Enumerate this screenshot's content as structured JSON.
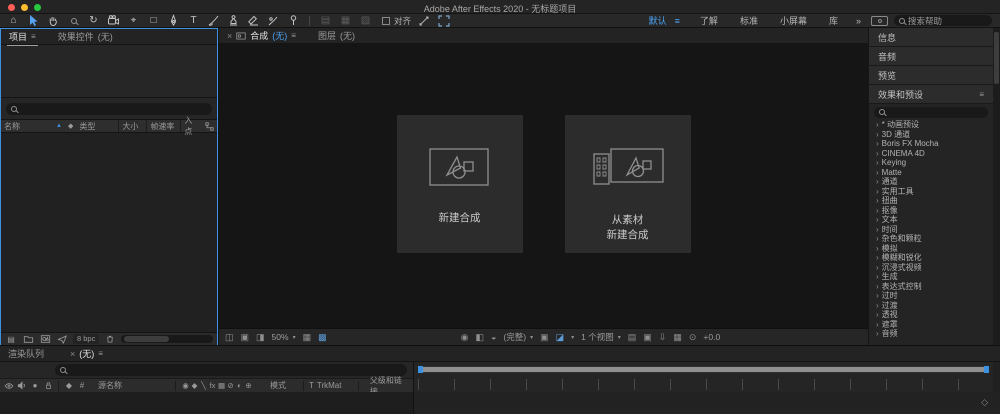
{
  "titlebar": {
    "title": "Adobe After Effects 2020 - 无标题项目"
  },
  "toolbar": {
    "align_label": "对齐",
    "workspaces": [
      "默认",
      "了解",
      "标准",
      "小屏幕",
      "库"
    ],
    "overflow_icon": "»",
    "help_search_placeholder": "搜索帮助"
  },
  "icons": {
    "home": "⌂",
    "rotate": "↻",
    "pan_behind": "⌖",
    "rect_tool": "□",
    "text_tool": "T",
    "menu": "≡",
    "close": "×",
    "sort_asc": "▲",
    "label_tag": "◆",
    "hash": "#",
    "solo": "●",
    "grayed_tools": [
      "▤",
      "▦",
      "▧"
    ],
    "switches": [
      "◉",
      "◆",
      "╲",
      "fx",
      "▦",
      "⊘",
      "◐",
      "⊕"
    ],
    "viewer_left": [
      "◫",
      "▣",
      "◨"
    ],
    "grid": "▦",
    "mask_vis": "▩",
    "snapshot": "◉",
    "show_snapshot": "◧",
    "channels": "◒",
    "roi": "▣",
    "transparency": "◪",
    "pixel_aspect": "▤",
    "fast_preview": "▣",
    "mini_timeline": "⇩",
    "flowchart": "▦",
    "reset_exposure": "⊙",
    "dropdown": "▾",
    "nav_hand": "◇"
  },
  "project_panel": {
    "tabs": {
      "project": "项目",
      "effect_controls": "效果控件",
      "effect_controls_suffix": "(无)"
    },
    "columns": {
      "name": "名称",
      "type": "类型",
      "size": "大小",
      "frame_rate": "帧速率",
      "in_point": "入点"
    },
    "bit_depth": "8 bpc"
  },
  "comp_panel": {
    "tabs": {
      "comp": "合成",
      "comp_suffix": "(无)",
      "layer": "图层",
      "layer_suffix": "(无)"
    },
    "new_comp_label": "新建合成",
    "from_footage_line1": "从素材",
    "from_footage_line2": "新建合成",
    "status": {
      "zoom": "50%",
      "resolution": "(完整)",
      "views": "1 个视图",
      "exposure": "+0.0"
    }
  },
  "right_panel": {
    "info_label": "信息",
    "audio_label": "音频",
    "preview_label": "预览",
    "effects_title": "效果和预设",
    "effects": [
      "* 动画预设",
      "3D 通道",
      "Boris FX Mocha",
      "CINEMA 4D",
      "Keying",
      "Matte",
      "通道",
      "实用工具",
      "扭曲",
      "抠像",
      "文本",
      "时间",
      "杂色和颗粒",
      "模拟",
      "模糊和锐化",
      "沉浸式视频",
      "生成",
      "表达式控制",
      "过时",
      "过渡",
      "透视",
      "遮罩",
      "音频"
    ]
  },
  "timeline": {
    "render_queue_tab": "渲染队列",
    "comp_tab": "(无)",
    "columns": {
      "hash": "#",
      "source_name": "源名称",
      "mode": "模式",
      "t": "T",
      "trkmat": "TrkMat",
      "parent": "父级和链接"
    }
  },
  "colors": {
    "accent": "#3E90E0"
  }
}
